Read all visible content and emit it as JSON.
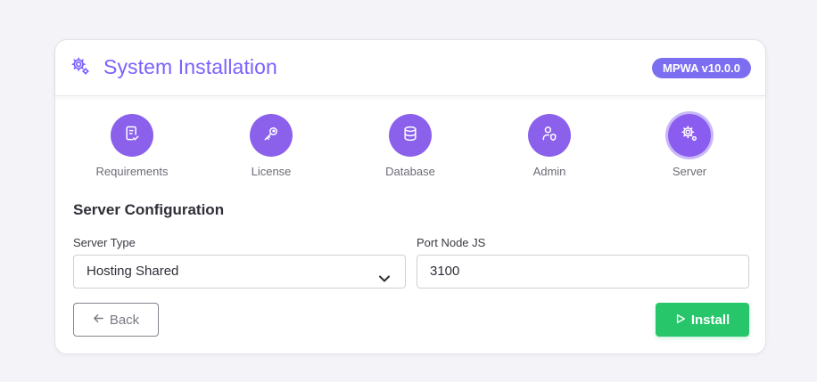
{
  "header": {
    "title": "System Installation",
    "version_badge": "MPWA v10.0.0",
    "icon": "gear-icon"
  },
  "steps": [
    {
      "label": "Requirements",
      "icon": "checklist-icon"
    },
    {
      "label": "License",
      "icon": "key-icon"
    },
    {
      "label": "Database",
      "icon": "database-icon"
    },
    {
      "label": "Admin",
      "icon": "user-shield-icon"
    },
    {
      "label": "Server",
      "icon": "gear-icon",
      "active": true
    }
  ],
  "form": {
    "section_title": "Server Configuration",
    "server_type_label": "Server Type",
    "server_type_value": "Hosting Shared",
    "port_label": "Port Node JS",
    "port_value": "3100"
  },
  "actions": {
    "back_label": "Back",
    "install_label": "Install"
  },
  "colors": {
    "accent": "#7b61ff",
    "step_circle": "#8b61ec",
    "badge": "#7c6ef0",
    "install_button": "#27c66a"
  }
}
